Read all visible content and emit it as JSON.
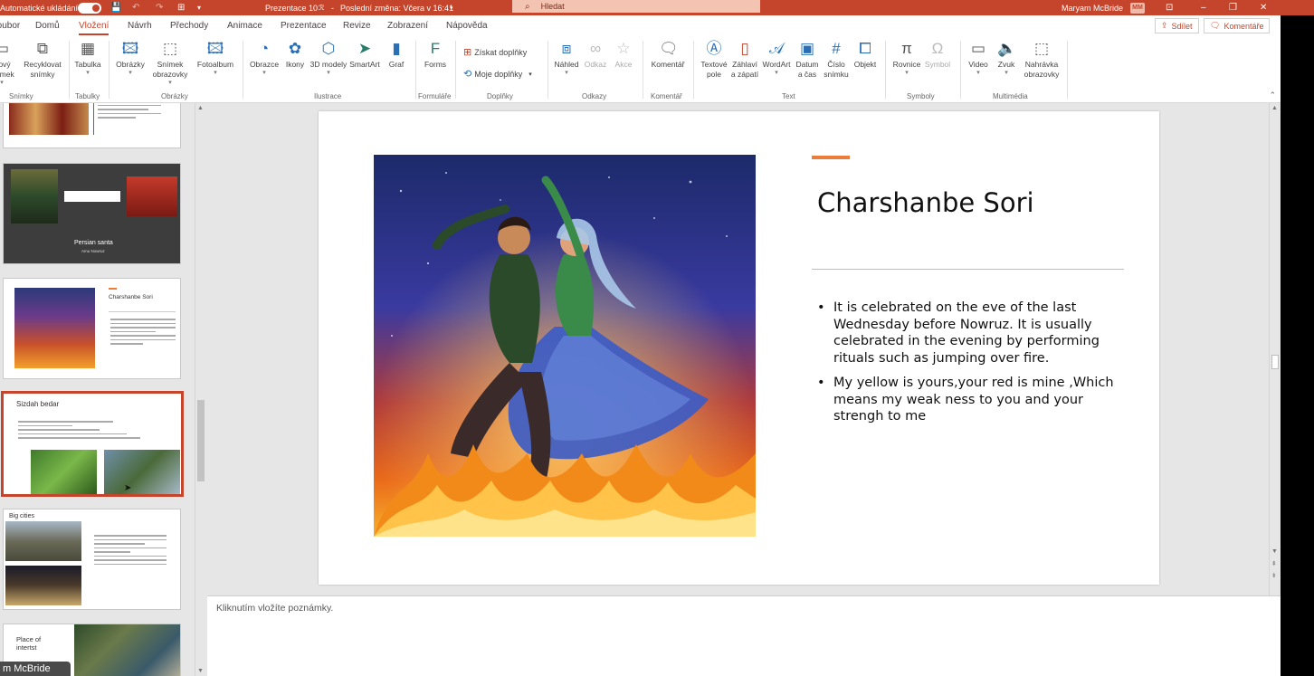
{
  "titlebar": {
    "autosave_label": "Automatické ukládání",
    "doc_title": "Prezentace 10",
    "last_change": "Poslední změna: Včera v 16:41",
    "search_placeholder": "Hledat",
    "user_name": "Maryam McBride",
    "user_initials": "MM"
  },
  "menu": {
    "tabs": [
      "Soubor",
      "Domů",
      "Vložení",
      "Návrh",
      "Přechody",
      "Animace",
      "Prezentace",
      "Revize",
      "Zobrazení",
      "Nápověda"
    ],
    "active_tab": "Vložení",
    "share_label": "Sdílet",
    "comments_label": "Komentáře"
  },
  "ribbon": {
    "new_slide": "Nový snímek",
    "reuse_slides": "Recyklovat snímky",
    "table": "Tabulka",
    "pictures": "Obrázky",
    "screenshot": "Snímek obrazovky",
    "photo_album": "Fotoalbum",
    "shapes": "Obrazce",
    "icons": "Ikony",
    "models3d": "3D modely",
    "smartart": "SmartArt",
    "chart": "Graf",
    "forms": "Forms",
    "get_addins": "Získat doplňky",
    "my_addins": "Moje doplňky",
    "zoom": "Náhled",
    "link": "Odkaz",
    "action": "Akce",
    "comment": "Komentář",
    "textbox": "Textové pole",
    "header_footer": "Záhlaví a zápatí",
    "wordart": "WordArt",
    "date_time": "Datum a čas",
    "slide_number": "Číslo snímku",
    "object": "Objekt",
    "equation": "Rovnice",
    "symbol": "Symbol",
    "video": "Video",
    "audio": "Zvuk",
    "screen_recording": "Nahrávka obrazovky",
    "groups": {
      "slides": "Snímky",
      "tables": "Tabulky",
      "images": "Obrázky",
      "illustrations": "Ilustrace",
      "forms": "Formuláře",
      "addins": "Doplňky",
      "links": "Odkazy",
      "comments": "Komentář",
      "text": "Text",
      "symbols": "Symboly",
      "media": "Multimédia"
    }
  },
  "thumbnails": [
    {
      "title": "",
      "subtitle": ""
    },
    {
      "title": "Persian santa",
      "subtitle": "Amu Nowruz"
    },
    {
      "title": "Charshanbe Sori"
    },
    {
      "title": "Sizdah bedar"
    },
    {
      "title": "Big cities"
    },
    {
      "title": "Place of intertst"
    }
  ],
  "slide": {
    "title": "Charshanbe Sori",
    "bullets": [
      "It is celebrated on the eve of the last Wednesday before Nowruz. It is usually celebrated in the evening by performing rituals such as jumping over fire.",
      "My yellow is yours,your red is mine ,Which means my weak ness to you and your strengh to me"
    ]
  },
  "notes": {
    "placeholder": "Kliknutím vložíte poznámky."
  },
  "overlay": {
    "name_badge": "m McBride"
  },
  "colors": {
    "accent": "#c4452b",
    "slide_accent": "#ec7c3a"
  }
}
